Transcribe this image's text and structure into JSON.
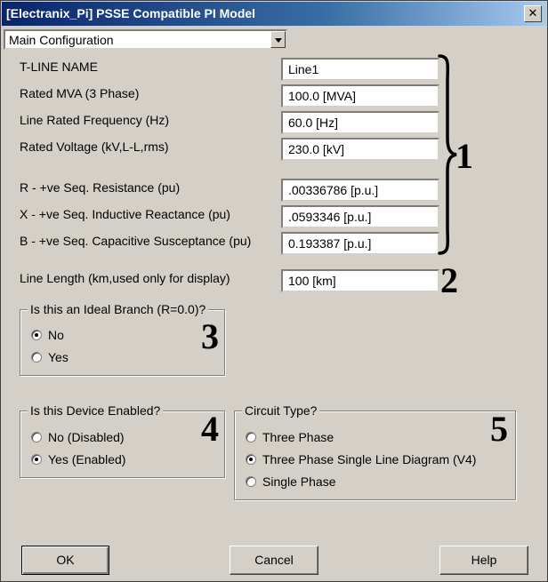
{
  "window": {
    "title": "[Electranix_Pi] PSSE Compatible PI Model"
  },
  "config_select": {
    "value": "Main Configuration"
  },
  "fields": [
    {
      "label": "T-LINE NAME",
      "value": "Line1"
    },
    {
      "label": "Rated MVA (3 Phase)",
      "value": "100.0 [MVA]"
    },
    {
      "label": "Line Rated Frequency (Hz)",
      "value": "60.0 [Hz]"
    },
    {
      "label": "Rated Voltage (kV,L-L,rms)",
      "value": "230.0 [kV]"
    },
    {
      "label": "R - +ve Seq. Resistance (pu)",
      "value": ".00336786 [p.u.]"
    },
    {
      "label": "X - +ve Seq. Inductive Reactance (pu)",
      "value": ".0593346 [p.u.]"
    },
    {
      "label": "B - +ve Seq. Capacitive Susceptance (pu)",
      "value": "0.193387 [p.u.]"
    },
    {
      "label": "Line Length (km,used only for display)",
      "value": "100 [km]"
    }
  ],
  "annotations": [
    "1",
    "2",
    "3",
    "4",
    "5"
  ],
  "ideal_branch": {
    "title": "Is this an Ideal Branch (R=0.0)?",
    "options": [
      {
        "label": "No",
        "checked": true
      },
      {
        "label": "Yes",
        "checked": false
      }
    ]
  },
  "device_enabled": {
    "title": "Is this Device Enabled?",
    "options": [
      {
        "label": "No (Disabled)",
        "checked": false
      },
      {
        "label": "Yes (Enabled)",
        "checked": true
      }
    ]
  },
  "circuit_type": {
    "title": "Circuit Type?",
    "options": [
      {
        "label": "Three Phase",
        "checked": false
      },
      {
        "label": "Three Phase Single Line Diagram (V4)",
        "checked": true
      },
      {
        "label": "Single Phase",
        "checked": false
      }
    ]
  },
  "buttons": {
    "ok": "OK",
    "cancel": "Cancel",
    "help": "Help"
  },
  "icons": {
    "close": "close-icon",
    "dropdown": "chevron-down-icon"
  },
  "colors": {
    "titlebar_start": "#0a246a",
    "titlebar_end": "#a6caf0",
    "dialog_bg": "#d4d0c8"
  }
}
